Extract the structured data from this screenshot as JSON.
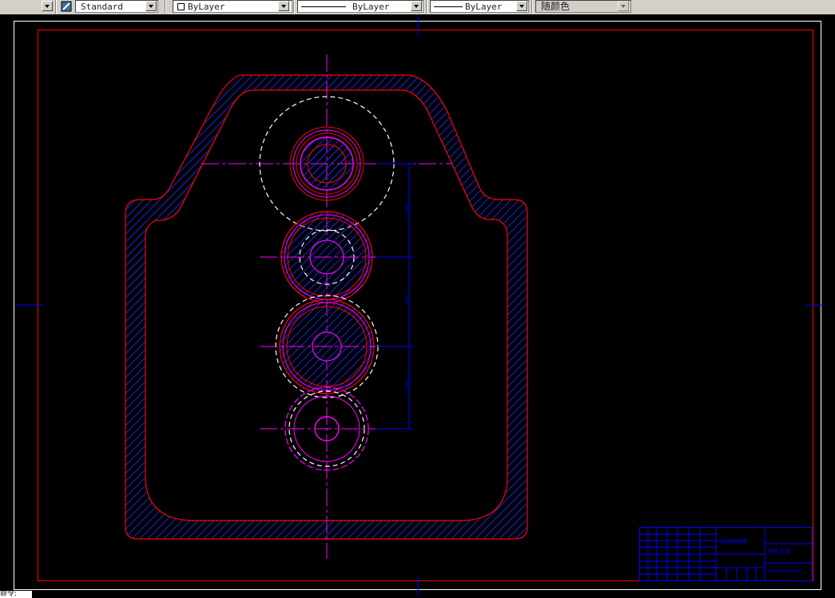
{
  "toolbar": {
    "text_style": "Standard",
    "layer": "ByLayer",
    "linetype": "ByLayer",
    "lineweight": "ByLayer",
    "plot_style": "随颜色"
  },
  "drawing": {
    "dimensions": [
      "200",
      "150",
      "160"
    ],
    "title_block": {
      "drawing_name": "齿轮箱装配图",
      "school": "学生大学",
      "drawing_number": "01000193J8-124"
    }
  },
  "command_line": {
    "prompt": "命令:"
  },
  "colors": {
    "background": "#000000",
    "frame": "#ff0000",
    "hatch": "#0000ff",
    "centerline": "#ff00ff",
    "hidden": "#ffffff"
  }
}
